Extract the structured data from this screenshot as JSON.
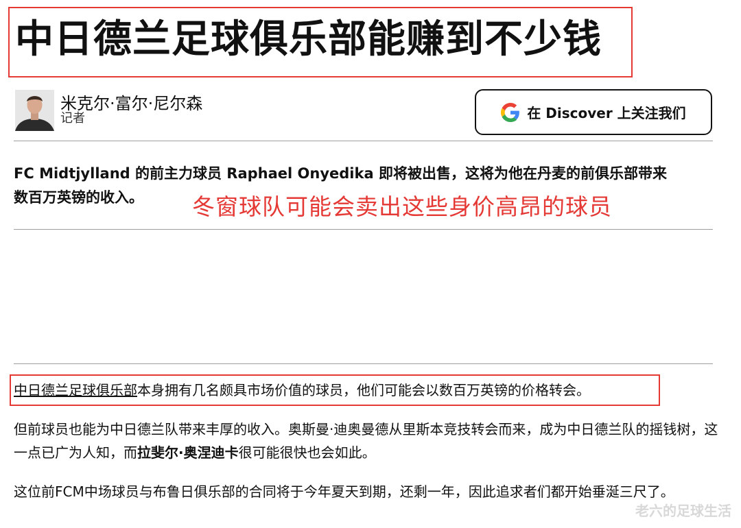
{
  "article": {
    "headline": "中日德兰足球俱乐部能赚到不少钱",
    "author": {
      "name": "米克尔·富尔·尼尔森",
      "role": "记者"
    },
    "discover_button": {
      "label": "在 Discover 上关注我们",
      "icon": "google-g-icon"
    },
    "lead": {
      "line1": "FC Midtjylland 的前主力球员 Raphael Onyedika 即将被出售，这将为他在丹麦的前俱乐部带来",
      "line2": "数百万英镑的收入。"
    },
    "paragraphs": {
      "p1_link": "中日德兰足球俱乐部",
      "p1_rest": "本身拥有几名颇具市场价值的球员，他们可能会以数百万英镑的价格转会。",
      "p2_a": "但前球员也能为中日德兰队带来丰厚的收入。奥斯曼·迪奥曼德从里斯本竞技转会而来，成为中日德兰队的摇钱树，这一点已广为人知，而",
      "p2_bold": "拉斐尔·奥涅迪卡",
      "p2_b": "很可能很快也会如此。",
      "p3": "这位前FCM中场球员与布鲁日俱乐部的合同将于今年夏天到期，还剩一年，因此追求者们都开始垂涎三尺了。"
    }
  },
  "overlay": {
    "red_caption": "冬窗球队可能会卖出这些身价高昂的球员",
    "watermark": "老六的足球生活"
  },
  "colors": {
    "annotation_red": "#e53935",
    "text": "#111111",
    "rule": "#9e9e9e"
  }
}
